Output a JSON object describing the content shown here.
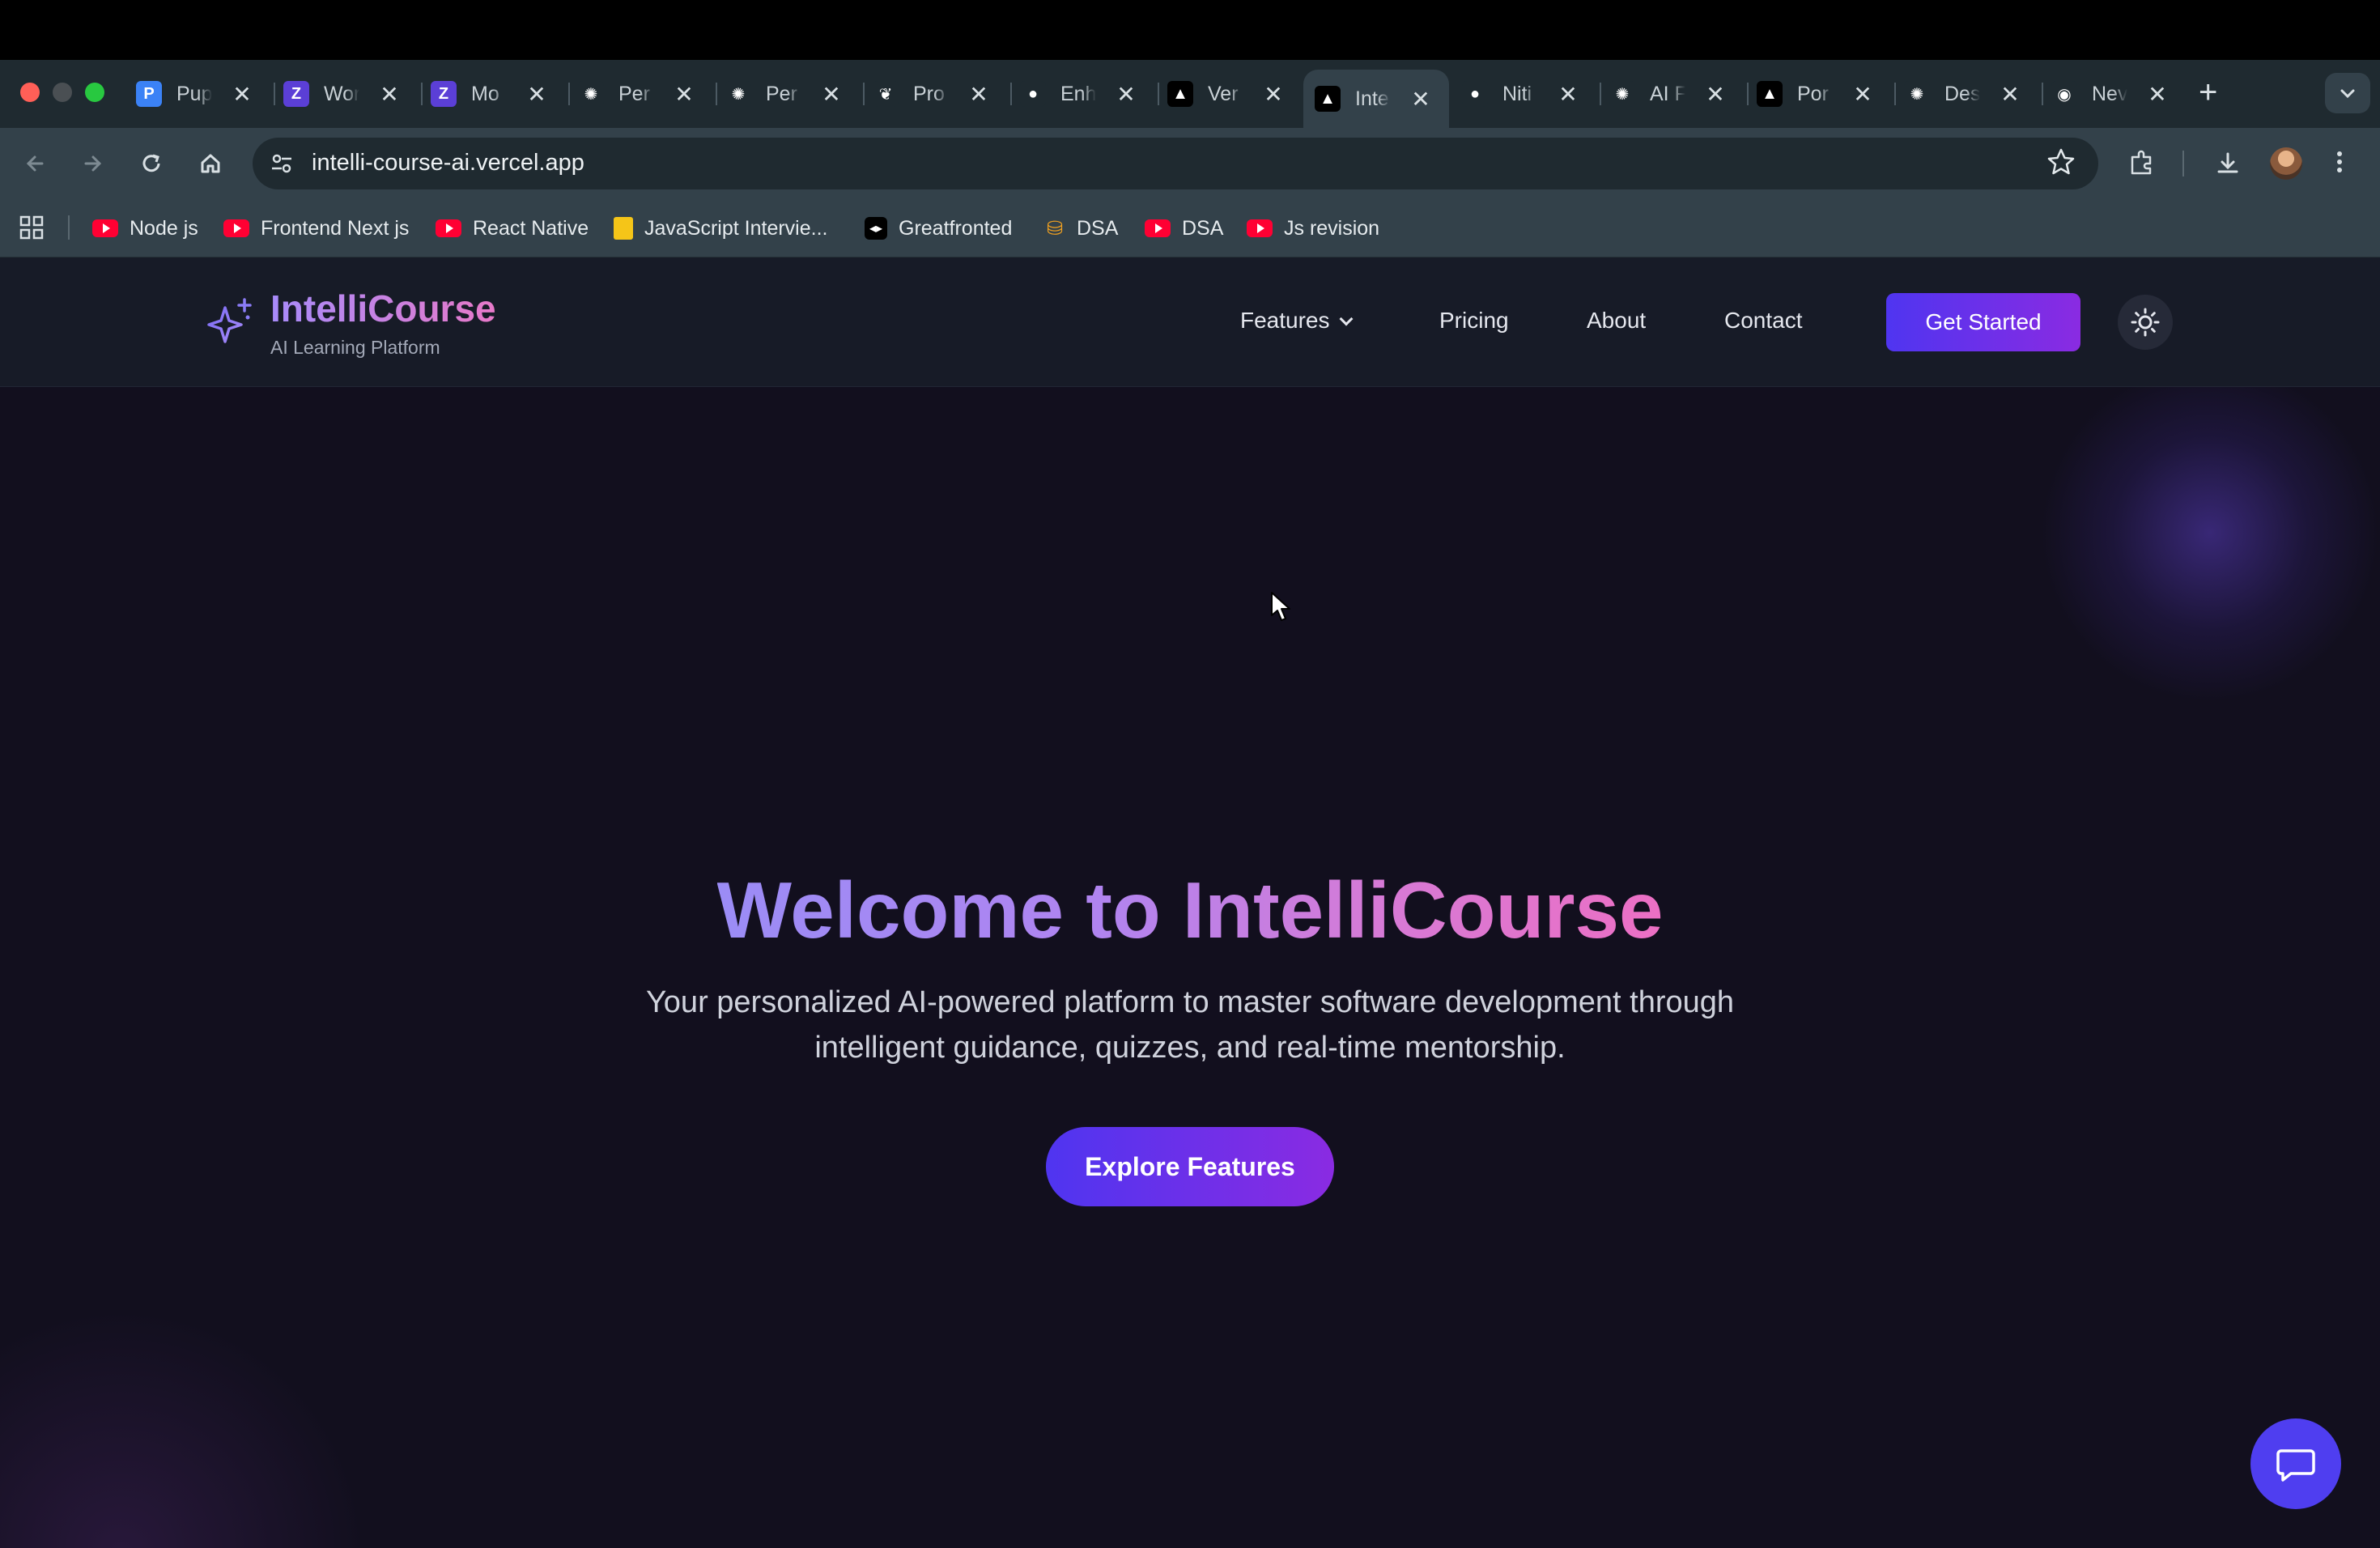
{
  "browser": {
    "tabs": [
      {
        "title": "Pup",
        "favicon": "p-icon",
        "color": "#3b82f6",
        "active": false
      },
      {
        "title": "Wor",
        "favicon": "z-icon",
        "color": "#5b3fd6",
        "active": false
      },
      {
        "title": "Mo",
        "favicon": "z-icon",
        "color": "#5b3fd6",
        "active": false
      },
      {
        "title": "Per",
        "favicon": "openai-icon",
        "color": "#1f2a30",
        "active": false
      },
      {
        "title": "Per",
        "favicon": "openai-icon",
        "color": "#1f2a30",
        "active": false
      },
      {
        "title": "Pro",
        "favicon": "leaf-icon",
        "color": "#1f2a30",
        "active": false
      },
      {
        "title": "Enh",
        "favicon": "github-icon",
        "color": "#1f2a30",
        "active": false
      },
      {
        "title": "Ver",
        "favicon": "vercel-icon",
        "color": "#000000",
        "active": false
      },
      {
        "title": "Inte",
        "favicon": "vercel-icon",
        "color": "#000000",
        "active": true
      },
      {
        "title": "Niti",
        "favicon": "github-icon",
        "color": "#1f2a30",
        "active": false
      },
      {
        "title": "AI F",
        "favicon": "openai-icon",
        "color": "#1f2a30",
        "active": false
      },
      {
        "title": "Por",
        "favicon": "vercel-icon",
        "color": "#000000",
        "active": false
      },
      {
        "title": "Des",
        "favicon": "openai-icon",
        "color": "#1f2a30",
        "active": false
      },
      {
        "title": "Nev",
        "favicon": "chrome-icon",
        "color": "#1f2a30",
        "active": false
      }
    ],
    "tab_close": "✕",
    "new_tab": "+",
    "url": "intelli-course-ai.vercel.app",
    "bookmarks": [
      {
        "label": "Node js",
        "icon": "youtube-icon"
      },
      {
        "label": "Frontend Next js",
        "icon": "youtube-icon"
      },
      {
        "label": "React Native",
        "icon": "youtube-icon"
      },
      {
        "label": "JavaScript Intervie...",
        "icon": "notebook-icon"
      },
      {
        "label": "Greatfronted",
        "icon": "greatfrontend-icon"
      },
      {
        "label": "DSA",
        "icon": "dsa-icon"
      },
      {
        "label": "DSA",
        "icon": "youtube-icon"
      },
      {
        "label": "Js revision",
        "icon": "youtube-icon"
      }
    ]
  },
  "site": {
    "brand": {
      "name": "IntelliCourse",
      "tagline": "AI Learning Platform"
    },
    "nav": {
      "features": "Features",
      "pricing": "Pricing",
      "about": "About",
      "contact": "Contact"
    },
    "cta": "Get Started",
    "hero": {
      "title": "Welcome to IntelliCourse",
      "subtitle_line1": "Your personalized AI-powered platform to master software development through",
      "subtitle_line2": "intelligent guidance, quizzes, and real-time mentorship.",
      "button": "Explore Features"
    },
    "colors": {
      "accent": "#5b3ff0",
      "accent2": "#8a2be2",
      "brand_gradient_start": "#a78bfa",
      "brand_gradient_end": "#ec6fc4",
      "background": "#120f1e"
    }
  }
}
